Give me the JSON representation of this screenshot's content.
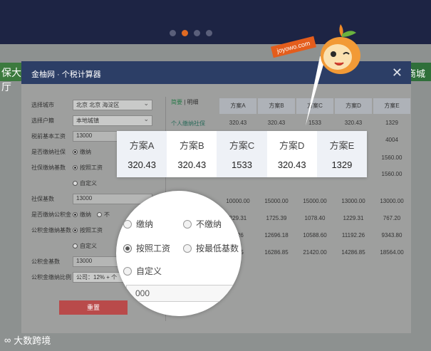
{
  "background": {
    "left_banner": "保大厅",
    "right_banner": "商城",
    "bottom_brand": "大数跨境"
  },
  "modal": {
    "title": "金柚网 · 个税计算器",
    "close_icon": "close-icon",
    "form": {
      "city_label": "选择城市",
      "city_value": "北京  北京  海淀区",
      "hukou_label": "选择户籍",
      "hukou_value": "本地城镇",
      "salary_label": "税前基本工资",
      "salary_value": "13000",
      "pay_social_label": "是否缴纳社保",
      "pay_social_option": "缴纳",
      "social_base_label": "社保缴纳基数",
      "social_base_option1": "按照工资",
      "social_base_option2": "自定义",
      "social_base_input_label": "社保基数",
      "social_base_input_value": "13000",
      "pay_fund_label": "是否缴纳公积金",
      "pay_fund_option": "缴纳",
      "pay_fund_option2": "不",
      "fund_base_label": "公积金缴纳基数",
      "fund_base_option1": "按照工资",
      "fund_base_option2": "自定义",
      "fund_base_input_label": "公积金基数",
      "fund_base_input_value": "13000",
      "fund_ratio_label": "公积金缴纳比例",
      "fund_ratio_value": "公司：12% + 个",
      "reset_button": "重置"
    },
    "results": {
      "tab_summary": "简要",
      "tab_separator": "|",
      "tab_detail": "明细",
      "row_label": "个人缴纳社保",
      "columns": [
        "方案A",
        "方案B",
        "方案C",
        "方案D",
        "方案E"
      ],
      "row1": [
        "320.43",
        "320.43",
        "1533",
        "320.43",
        "1329"
      ],
      "row_e_extra": [
        "4004",
        "1560.00",
        "1560.00"
      ],
      "row_base": [
        "10000.00",
        "15000.00",
        "15000.00",
        "13000.00",
        "13000.00"
      ],
      "row_tax": [
        "229.31",
        "1725.39",
        "1078.40",
        "1229.31",
        "767.20"
      ],
      "row_c": [
        "?.26",
        "12696.18",
        "10588.60",
        "11192.26",
        "9343.80"
      ],
      "row_d": [
        "?.85",
        "16286.85",
        "21420.00",
        "14286.85",
        "18564.00"
      ]
    }
  },
  "callout_card": {
    "columns": [
      "方案A",
      "方案B",
      "方案C",
      "方案D",
      "方案E"
    ],
    "values": [
      "320.43",
      "320.43",
      "1533",
      "320.43",
      "1329"
    ]
  },
  "zoom": {
    "option1": "缴纳",
    "option2": "不缴纳",
    "option3": "按照工资",
    "option4": "按最低基数",
    "option5": "自定义",
    "input_value": "000"
  },
  "mascot": {
    "tag": "joyowo.com"
  }
}
